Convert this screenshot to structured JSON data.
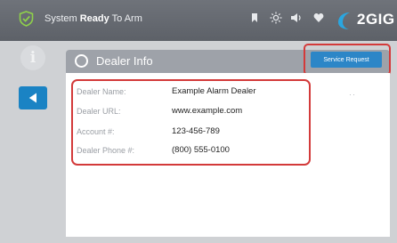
{
  "status_bar": {
    "prefix": "System ",
    "status": "Ready",
    "suffix": " To Arm",
    "icons": [
      "shield-check-icon",
      "bookmark-icon",
      "brightness-icon",
      "volume-icon",
      "heart-icon"
    ]
  },
  "brand": {
    "logo_text": "2GIG"
  },
  "page": {
    "title": "Dealer Info"
  },
  "service_request": {
    "label": "Service Request"
  },
  "dealer": {
    "rows": [
      {
        "label": "Dealer Name:",
        "value": "Example Alarm Dealer"
      },
      {
        "label": "Dealer URL:",
        "value": "www.example.com"
      },
      {
        "label": "Account #:",
        "value": "123-456-789"
      },
      {
        "label": "Dealer Phone #:",
        "value": "(800) 555-0100"
      }
    ]
  },
  "colors": {
    "accent_blue": "#1a83c4",
    "highlight_red": "#d33a3a",
    "header_gray": "#6f737a",
    "title_gray": "#9ea2a9"
  }
}
